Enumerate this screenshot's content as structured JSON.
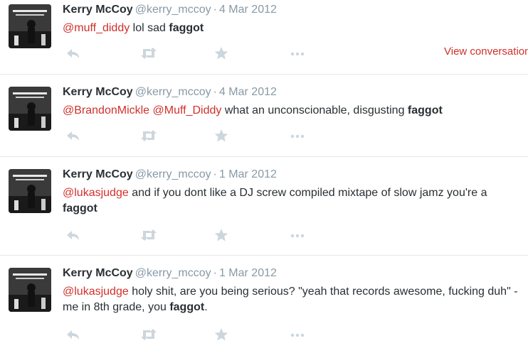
{
  "tweets": [
    {
      "name": "Kerry McCoy",
      "handle": "@kerry_mccoy",
      "separator": "·",
      "date": "4 Mar 2012",
      "mentions": [
        "@muff_diddy"
      ],
      "text_mid": " lol sad ",
      "bold_word": "faggot",
      "text_end": "",
      "view_link": "View conversation"
    },
    {
      "name": "Kerry McCoy",
      "handle": "@kerry_mccoy",
      "separator": "·",
      "date": "4 Mar 2012",
      "mentions": [
        "@BrandonMickle",
        "@Muff_Diddy"
      ],
      "text_mid": " what an unconscionable, disgusting ",
      "bold_word": "faggot",
      "text_end": ""
    },
    {
      "name": "Kerry McCoy",
      "handle": "@kerry_mccoy",
      "separator": "·",
      "date": "1 Mar 2012",
      "mentions": [
        "@lukasjudge"
      ],
      "text_mid": " and if you dont like a DJ screw compiled mixtape of slow jamz you're a ",
      "bold_word": "faggot",
      "text_end": ""
    },
    {
      "name": "Kerry McCoy",
      "handle": "@kerry_mccoy",
      "separator": "·",
      "date": "1 Mar 2012",
      "mentions": [
        "@lukasjudge"
      ],
      "text_mid": " holy shit, are you being serious? \"yeah that records awesome, fucking duh\" - me in 8th grade, you ",
      "bold_word": "faggot",
      "text_end": "."
    }
  ],
  "actions": [
    "reply-icon",
    "retweet-icon",
    "favorite-icon",
    "more-icon"
  ],
  "colors": {
    "mention": "#d0302b",
    "meta": "#8899a6",
    "icon": "#ccd6dd"
  }
}
